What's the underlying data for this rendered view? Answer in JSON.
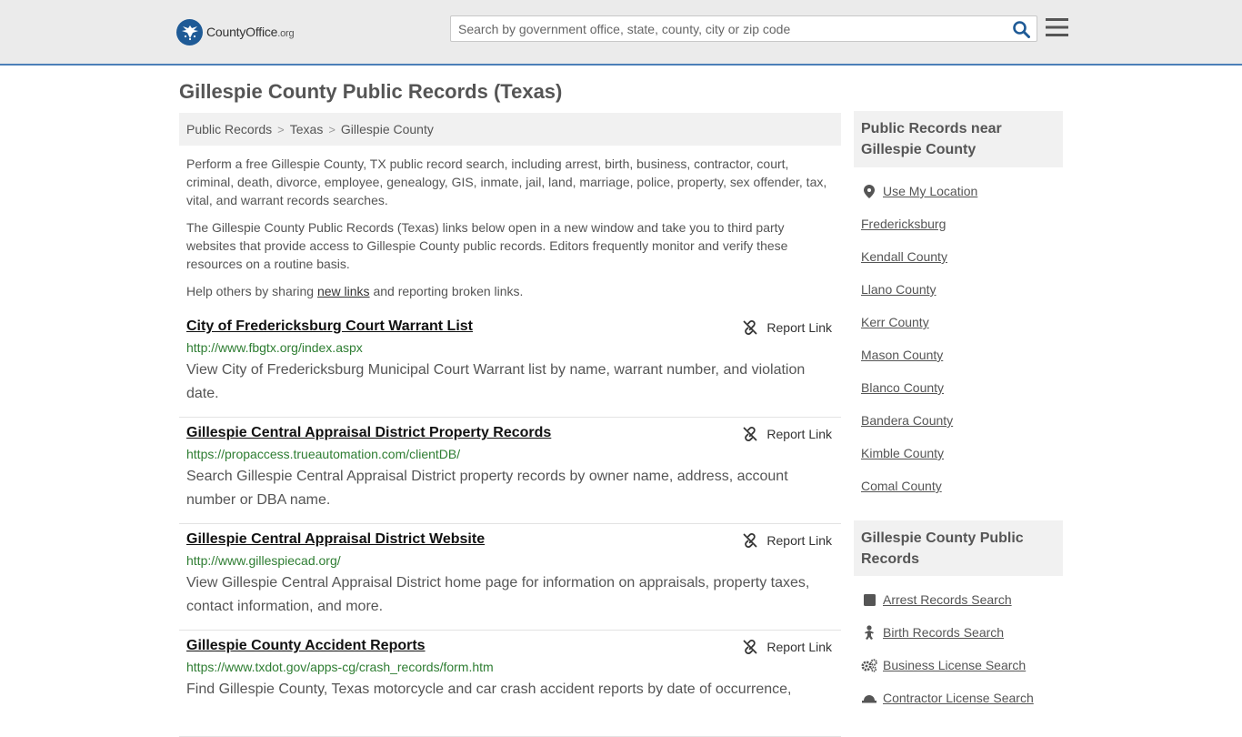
{
  "header": {
    "logo_main": "CountyOffice",
    "logo_suffix": ".org",
    "search_placeholder": "Search by government office, state, county, city or zip code",
    "accent_color": "#4b7fb8"
  },
  "page": {
    "title": "Gillespie County Public Records (Texas)"
  },
  "breadcrumb": [
    "Public Records",
    "Texas",
    "Gillespie County"
  ],
  "intro": {
    "paragraph1": "Perform a free Gillespie County, TX public record search, including arrest, birth, business, contractor, court, criminal, death, divorce, employee, genealogy, GIS, inmate, jail, land, marriage, police, property, sex offender, tax, vital, and warrant records searches.",
    "paragraph2": "The Gillespie County Public Records (Texas) links below open in a new window and take you to third party websites that provide access to Gillespie County public records. Editors frequently monitor and verify these resources on a routine basis.",
    "help_prefix": "Help others by sharing ",
    "help_link": "new links",
    "help_suffix": " and reporting broken links."
  },
  "records": [
    {
      "title": "City of Fredericksburg Court Warrant List",
      "url": "http://www.fbgtx.org/index.aspx",
      "description": "View City of Fredericksburg Municipal Court Warrant list by name, warrant number, and violation date.",
      "report_label": "Report Link"
    },
    {
      "title": "Gillespie Central Appraisal District Property Records",
      "url": "https://propaccess.trueautomation.com/clientDB/",
      "description": "Search Gillespie Central Appraisal District property records by owner name, address, account number or DBA name.",
      "report_label": "Report Link"
    },
    {
      "title": "Gillespie Central Appraisal District Website",
      "url": "http://www.gillespiecad.org/",
      "description": "View Gillespie Central Appraisal District home page for information on appraisals, property taxes, contact information, and more.",
      "report_label": "Report Link"
    },
    {
      "title": "Gillespie County Accident Reports",
      "url": "https://www.txdot.gov/apps-cg/crash_records/form.htm",
      "description": "Find Gillespie County, Texas motorcycle and car crash accident reports by date of occurrence,",
      "report_label": "Report Link"
    }
  ],
  "sidebar": {
    "nearby_heading": "Public Records near Gillespie County",
    "use_location": "Use My Location",
    "nearby": [
      "Fredericksburg",
      "Kendall County",
      "Llano County",
      "Kerr County",
      "Mason County",
      "Blanco County",
      "Bandera County",
      "Kimble County",
      "Comal County"
    ],
    "records_heading": "Gillespie County Public Records",
    "record_links": [
      {
        "label": "Arrest Records Search",
        "icon": "square-icon"
      },
      {
        "label": "Birth Records Search",
        "icon": "baby-icon"
      },
      {
        "label": "Business License Search",
        "icon": "gears-icon"
      },
      {
        "label": "Contractor License Search",
        "icon": "hardhat-icon"
      }
    ]
  }
}
